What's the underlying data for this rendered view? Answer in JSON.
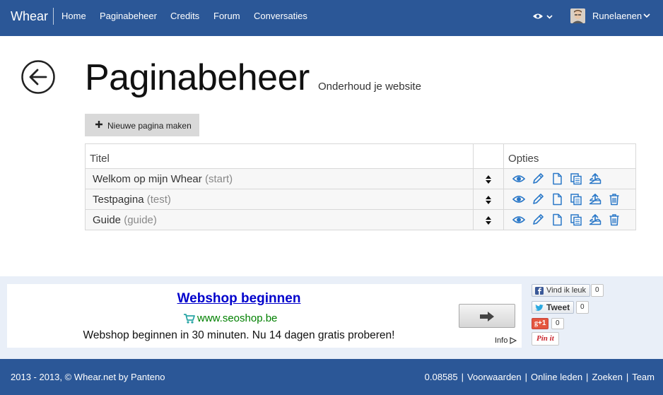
{
  "nav": {
    "brand": "Whear",
    "items": [
      "Home",
      "Paginabeheer",
      "Credits",
      "Forum",
      "Conversaties"
    ],
    "username": "Runelaenen"
  },
  "header": {
    "title": "Paginabeheer",
    "subtitle": "Onderhoud je website",
    "new_page_label": "Nieuwe pagina maken"
  },
  "table": {
    "columns": [
      "Titel",
      "",
      "Opties"
    ],
    "rows": [
      {
        "title": "Welkom op mijn Whear",
        "slug": "(start)",
        "deletable": false
      },
      {
        "title": "Testpagina",
        "slug": "(test)",
        "deletable": true
      },
      {
        "title": "Guide",
        "slug": "(guide)",
        "deletable": true
      }
    ]
  },
  "ad": {
    "title": "Webshop beginnen",
    "url": "www.seoshop.be",
    "text": "Webshop beginnen in 30 minuten. Nu 14 dagen gratis proberen!",
    "info": "Info"
  },
  "social": {
    "facebook_label": "Vind ik leuk",
    "facebook_count": "0",
    "twitter_label": "Tweet",
    "twitter_count": "0",
    "gplus_label": "+1",
    "gplus_count": "0",
    "pinterest_label": "Pin it"
  },
  "footer": {
    "copyright": "2013 - 2013, © Whear.net by Panteno",
    "version": "0.08585",
    "links": [
      "Voorwaarden",
      "Online leden",
      "Zoeken",
      "Team"
    ]
  },
  "colors": {
    "brand_blue": "#2b5797",
    "icon_blue": "#2a78c8",
    "ad_band": "#e9eff8"
  }
}
